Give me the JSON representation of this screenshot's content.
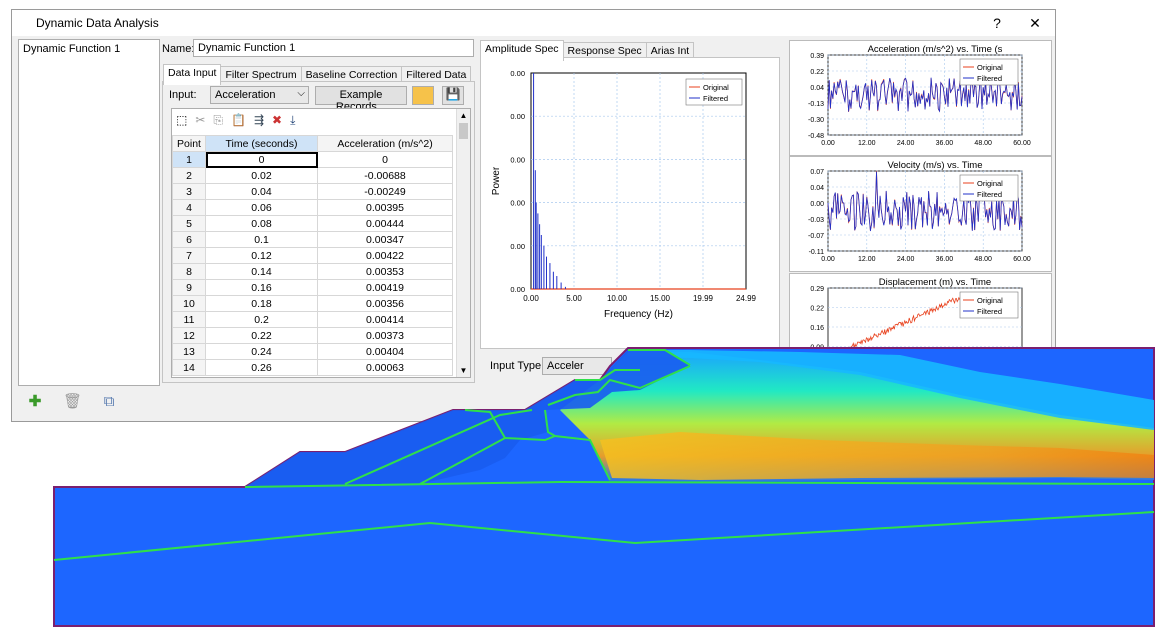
{
  "window": {
    "title": "Dynamic Data Analysis",
    "help": "?",
    "close": "✕"
  },
  "function_list": {
    "items": [
      "Dynamic Function 1"
    ]
  },
  "name_field": {
    "label": "Name:",
    "value": "Dynamic Function 1"
  },
  "left_tabs": [
    "Data Input",
    "Filter Spectrum",
    "Baseline Correction",
    "Filtered Data"
  ],
  "input": {
    "label": "Input:",
    "selected": "Acceleration",
    "example_button": "Example Records..."
  },
  "table": {
    "headers": [
      "Point",
      "Time (seconds)",
      "Acceleration (m/s^2)"
    ],
    "rows": [
      [
        "1",
        "0",
        "0"
      ],
      [
        "2",
        "0.02",
        "-0.00688"
      ],
      [
        "3",
        "0.04",
        "-0.00249"
      ],
      [
        "4",
        "0.06",
        "0.00395"
      ],
      [
        "5",
        "0.08",
        "0.00444"
      ],
      [
        "6",
        "0.1",
        "0.00347"
      ],
      [
        "7",
        "0.12",
        "0.00422"
      ],
      [
        "8",
        "0.14",
        "0.00353"
      ],
      [
        "9",
        "0.16",
        "0.00419"
      ],
      [
        "10",
        "0.18",
        "0.00356"
      ],
      [
        "11",
        "0.2",
        "0.00414"
      ],
      [
        "12",
        "0.22",
        "0.00373"
      ],
      [
        "13",
        "0.24",
        "0.00404"
      ],
      [
        "14",
        "0.26",
        "0.00063"
      ]
    ]
  },
  "spec_tabs": [
    "Amplitude Spec",
    "Response Spec",
    "Arias Int"
  ],
  "input_type": {
    "label": "Input Type:",
    "value": "Acceler"
  },
  "colors": {
    "original": "#e8401c",
    "filtered": "#2030c8",
    "grid": "#a9c8ee"
  },
  "chart_data": [
    {
      "type": "line",
      "title": "",
      "xlabel": "Frequency (Hz)",
      "ylabel": "Power",
      "x_ticks": [
        "0.00",
        "5.00",
        "10.00",
        "15.00",
        "19.99",
        "24.99"
      ],
      "y_ticks": [
        "0.00",
        "0.00",
        "0.00",
        "0.00",
        "0.00",
        "0.00"
      ],
      "xlim": [
        0,
        24.99
      ],
      "legend": {
        "position": "top-right",
        "entries": [
          "Original",
          "Filtered"
        ]
      },
      "series": [
        {
          "name": "Original",
          "x": [
            0,
            5,
            10,
            15,
            19.99,
            24.99
          ],
          "y": [
            0,
            0,
            0,
            0,
            0,
            0
          ]
        },
        {
          "name": "Filtered",
          "x": [
            0.3,
            0.5,
            0.6,
            0.8,
            1.0,
            1.2,
            1.5,
            1.8,
            2.2,
            2.6,
            3.0,
            3.5,
            4.0
          ],
          "y": [
            1.0,
            0.55,
            0.4,
            0.35,
            0.3,
            0.25,
            0.2,
            0.15,
            0.12,
            0.08,
            0.06,
            0.03,
            0.01
          ]
        }
      ],
      "grid": true
    },
    {
      "type": "line",
      "title": "Acceleration (m/s^2) vs. Time (s",
      "x_ticks": [
        "0.00",
        "12.00",
        "24.00",
        "36.00",
        "48.00",
        "60.00"
      ],
      "y_ticks": [
        "0.39",
        "0.22",
        "0.04",
        "-0.13",
        "-0.30",
        "-0.48"
      ],
      "xlim": [
        0,
        60
      ],
      "ylim": [
        -0.48,
        0.39
      ],
      "legend": {
        "position": "top-right",
        "entries": [
          "Original",
          "Filtered"
        ]
      },
      "grid": true
    },
    {
      "type": "line",
      "title": "Velocity (m/s) vs. Time",
      "x_ticks": [
        "0.00",
        "12.00",
        "24.00",
        "36.00",
        "48.00",
        "60.00"
      ],
      "y_ticks": [
        "0.07",
        "0.04",
        "0.00",
        "-0.03",
        "-0.07",
        "-0.11"
      ],
      "xlim": [
        0,
        60
      ],
      "ylim": [
        -0.11,
        0.07
      ],
      "legend": {
        "position": "top-right",
        "entries": [
          "Original",
          "Filtered"
        ]
      },
      "grid": true
    },
    {
      "type": "line",
      "title": "Displacement (m) vs. Time",
      "y_ticks": [
        "0.29",
        "0.22",
        "0.16",
        "0.09"
      ],
      "legend": {
        "position": "top-right",
        "entries": [
          "Original",
          "Filtered"
        ]
      },
      "grid": true
    }
  ]
}
